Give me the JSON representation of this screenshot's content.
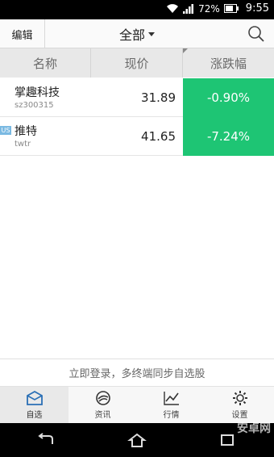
{
  "status_bar": {
    "battery_percent": "72%",
    "time": "9:55"
  },
  "header": {
    "edit_label": "编辑",
    "title": "全部"
  },
  "columns": {
    "name": "名称",
    "price": "现价",
    "change": "涨跌幅"
  },
  "stocks": [
    {
      "name": "掌趣科技",
      "code": "sz300315",
      "price": "31.89",
      "change": "-0.90%",
      "badge": ""
    },
    {
      "name": "推特",
      "code": "twtr",
      "price": "41.65",
      "change": "-7.24%",
      "badge": "US"
    }
  ],
  "login_prompt": "立即登录，多终端同步自选股",
  "tabs": [
    {
      "label": "自选",
      "icon": "watchlist-icon",
      "active": true
    },
    {
      "label": "资讯",
      "icon": "news-icon",
      "active": false
    },
    {
      "label": "行情",
      "icon": "market-chart-icon",
      "active": false
    },
    {
      "label": "设置",
      "icon": "gear-icon",
      "active": false
    }
  ],
  "watermark": "安卓网",
  "colors": {
    "change_down_bg": "#1ec574",
    "header_bg": "#e8e8e8"
  }
}
